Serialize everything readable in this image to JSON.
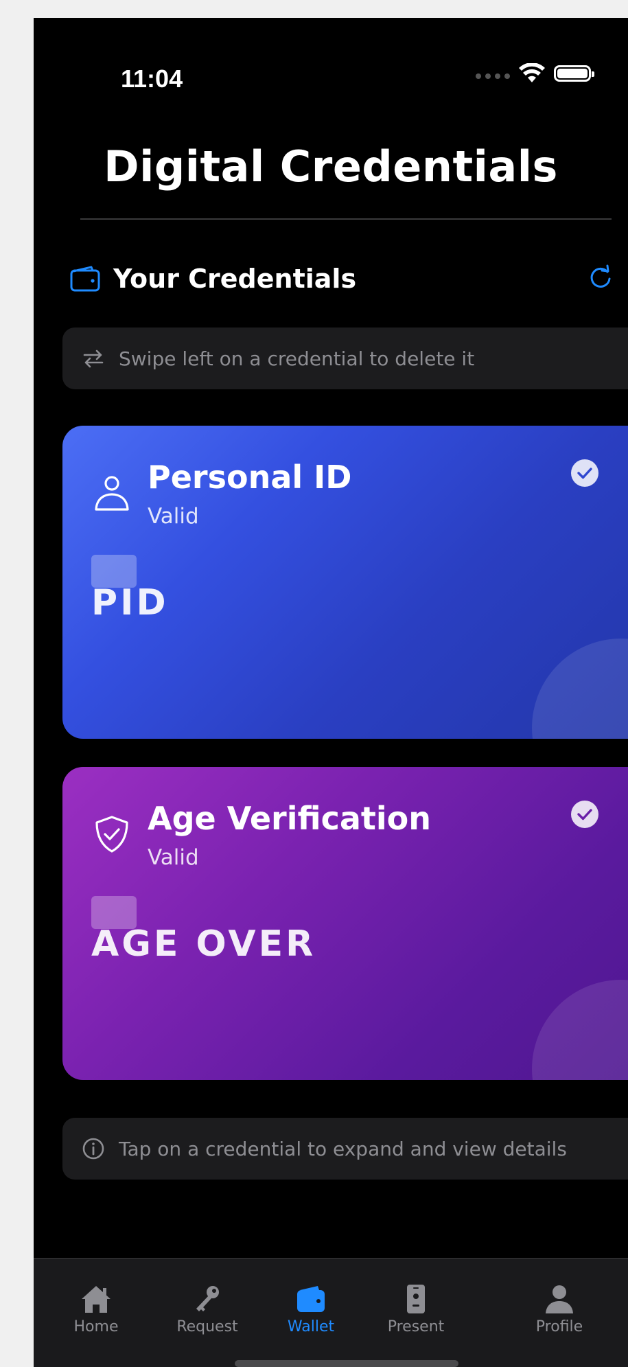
{
  "status_bar": {
    "time": "11:04"
  },
  "header": {
    "title": "Digital Credentials"
  },
  "section": {
    "title": "Your Credentials",
    "icon": "wallet-icon",
    "refresh_icon": "refresh-icon"
  },
  "hint": {
    "text": "Swipe left on a credential to delete it",
    "icon": "swap-arrows-icon"
  },
  "credentials": [
    {
      "title": "Personal ID",
      "status": "Valid",
      "code": "PID",
      "icon": "person-icon",
      "gradient_start": "#4c6ef5",
      "gradient_end": "#2336a8"
    },
    {
      "title": "Age Verification",
      "status": "Valid",
      "code": "AGE OVER",
      "icon": "shield-check-icon",
      "gradient_start": "#9b2fc2",
      "gradient_end": "#4e178f"
    }
  ],
  "info": {
    "text": "Tap on a credential to expand and view details",
    "icon": "info-icon"
  },
  "tabs": [
    {
      "label": "Home",
      "icon": "house-icon",
      "active": false
    },
    {
      "label": "Request",
      "icon": "key-icon",
      "active": false
    },
    {
      "label": "Wallet",
      "icon": "wallet-icon",
      "active": true
    },
    {
      "label": "Present",
      "icon": "badge-icon",
      "active": false
    },
    {
      "label": "Profile",
      "icon": "person-icon",
      "active": false
    }
  ],
  "colors": {
    "accent": "#1f8bff",
    "background": "#000000",
    "surface": "#1c1c1e",
    "muted_text": "#8e8e93"
  }
}
